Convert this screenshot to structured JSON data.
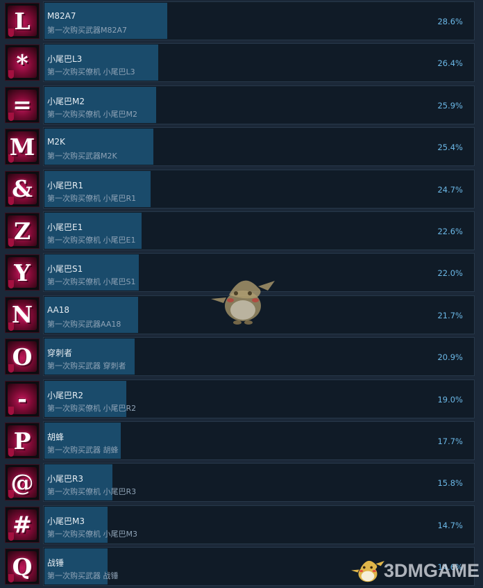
{
  "achievements": [
    {
      "icon_letter": "L",
      "name": "M82A7",
      "desc": "第一次购买武器M82A7",
      "percent_label": "28.6%",
      "percent": 28.6
    },
    {
      "icon_letter": "*",
      "name": "小尾巴L3",
      "desc": "第一次购买僚机 小尾巴L3",
      "percent_label": "26.4%",
      "percent": 26.4
    },
    {
      "icon_letter": "=",
      "name": "小尾巴M2",
      "desc": "第一次购买僚机 小尾巴M2",
      "percent_label": "25.9%",
      "percent": 25.9
    },
    {
      "icon_letter": "M",
      "name": "M2K",
      "desc": "第一次购买武器M2K",
      "percent_label": "25.4%",
      "percent": 25.4
    },
    {
      "icon_letter": "&",
      "name": "小尾巴R1",
      "desc": "第一次购买僚机 小尾巴R1",
      "percent_label": "24.7%",
      "percent": 24.7
    },
    {
      "icon_letter": "Z",
      "name": "小尾巴E1",
      "desc": "第一次购买僚机 小尾巴E1",
      "percent_label": "22.6%",
      "percent": 22.6
    },
    {
      "icon_letter": "Y",
      "name": "小尾巴S1",
      "desc": "第一次购买僚机 小尾巴S1",
      "percent_label": "22.0%",
      "percent": 22.0
    },
    {
      "icon_letter": "N",
      "name": "AA18",
      "desc": "第一次购买武器AA18",
      "percent_label": "21.7%",
      "percent": 21.7
    },
    {
      "icon_letter": "O",
      "name": "穿刺者",
      "desc": "第一次购买武器 穿刺者",
      "percent_label": "20.9%",
      "percent": 20.9
    },
    {
      "icon_letter": "-",
      "name": "小尾巴R2",
      "desc": "第一次购买僚机 小尾巴R2",
      "percent_label": "19.0%",
      "percent": 19.0
    },
    {
      "icon_letter": "P",
      "name": "胡蜂",
      "desc": "第一次购买武器 胡蜂",
      "percent_label": "17.7%",
      "percent": 17.7
    },
    {
      "icon_letter": "@",
      "name": "小尾巴R3",
      "desc": "第一次购买僚机 小尾巴R3",
      "percent_label": "15.8%",
      "percent": 15.8
    },
    {
      "icon_letter": "#",
      "name": "小尾巴M3",
      "desc": "第一次购买僚机 小尾巴M3",
      "percent_label": "14.7%",
      "percent": 14.7
    },
    {
      "icon_letter": "Q",
      "name": "战锤",
      "desc": "第一次购买武器 战锤",
      "percent_label": "14.6%",
      "percent": 14.6
    }
  ],
  "watermark": {
    "text": "3DMGAME",
    "icon": "duck-mascot-icon"
  },
  "center_watermark": {
    "icon": "duck-mascot-icon"
  },
  "colors": {
    "background": "#1b2838",
    "progress_fill": "#1a4b6b",
    "percent_text": "#6cb9e8",
    "icon_accent": "#c2185b"
  }
}
